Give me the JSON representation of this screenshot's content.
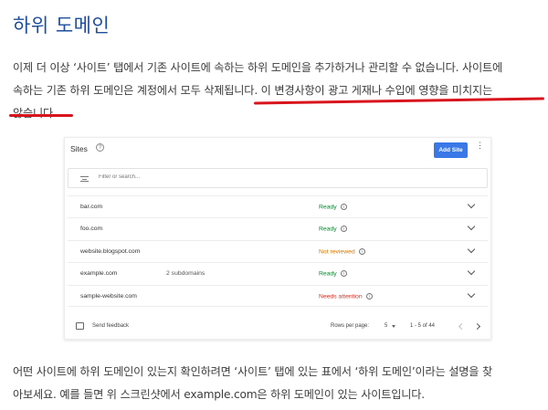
{
  "heading": "하위 도메인",
  "para1": {
    "line1": "이제 더 이상 ‘사이트’ 탭에서 기존 사이트에 속하는 하위 도메인을 추가하거나 관리할 수 없습니다. 사이트에",
    "line2_plain": "속하는 기존 하위 도메인은 계정에서 모두 삭제됩니다.",
    "line2_marked": " 이 변경사항이 광고 게재나 수입에 영향을 미치지는",
    "line3_marked": "않습니다."
  },
  "sites_card": {
    "title": "Sites",
    "add_button": "Add Site",
    "filter_placeholder": "Filter or search...",
    "rows": [
      {
        "domain": "bar.com",
        "subdomains": "",
        "status": "Ready",
        "status_type": "ready"
      },
      {
        "domain": "foo.com",
        "subdomains": "",
        "status": "Ready",
        "status_type": "ready"
      },
      {
        "domain": "website.blogspot.com",
        "subdomains": "",
        "status": "Not reviewed",
        "status_type": "warn"
      },
      {
        "domain": "example.com",
        "subdomains": "2 subdomains",
        "status": "Ready",
        "status_type": "ready"
      },
      {
        "domain": "sample-website.com",
        "subdomains": "",
        "status": "Needs attention",
        "status_type": "err"
      }
    ],
    "footer": {
      "feedback": "Send feedback",
      "rows_per_page_label": "Rows per page:",
      "rows_per_page_value": "5",
      "range": "1 - 5 of 44"
    }
  },
  "para2": {
    "line1": "어떤 사이트에 하위 도메인이 있는지 확인하려면 ‘사이트’ 탭에 있는 표에서 ‘하위 도메인’이라는 설명을 찾",
    "line2": "아보세요. 예를 들면 위 스크린샷에서 example.com은 하위 도메인이 있는 사이트입니다."
  },
  "colors": {
    "heading": "#1f4e9c",
    "underline": "#d8141c",
    "button": "#3b78e7",
    "ready": "#188038",
    "not_reviewed": "#e37400",
    "needs_attention": "#d93025"
  }
}
